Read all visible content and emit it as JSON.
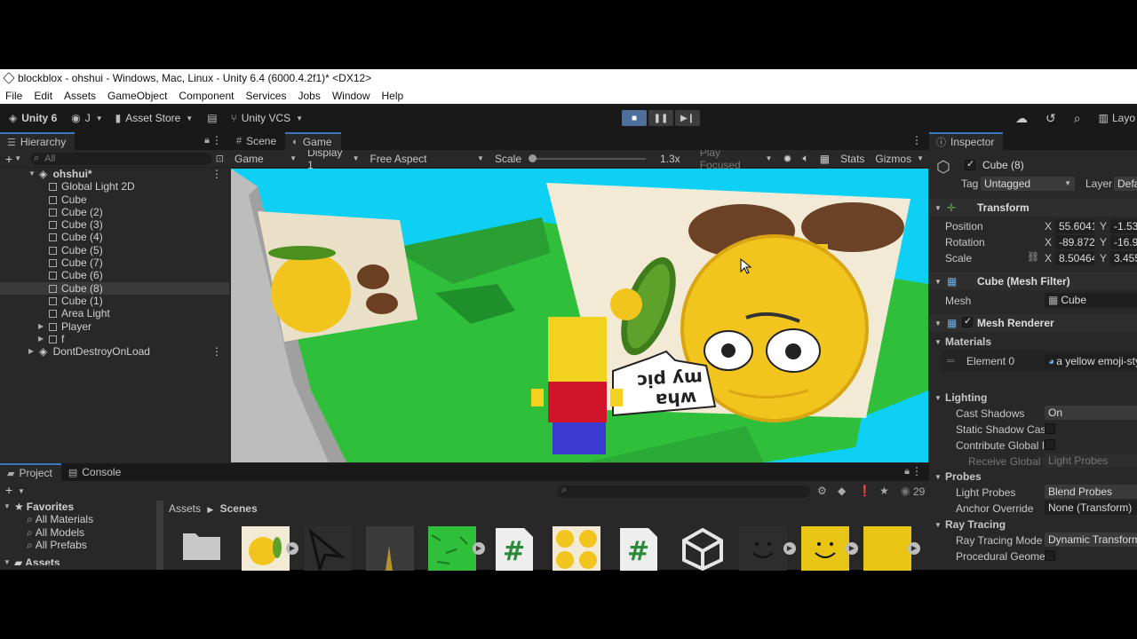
{
  "window": {
    "title": "blockblox - ohshui - Windows, Mac, Linux - Unity 6.4 (6000.4.2f1)* <DX12>"
  },
  "menu": [
    "File",
    "Edit",
    "Assets",
    "GameObject",
    "Component",
    "Services",
    "Jobs",
    "Window",
    "Help"
  ],
  "toolbar": {
    "unity_label": "Unity 6",
    "account_label": "J",
    "asset_store_label": "Asset Store",
    "vcs_label": "Unity VCS",
    "layout_label": "Layo"
  },
  "hierarchy": {
    "tab_label": "Hierarchy",
    "search_placeholder": "All",
    "scene_name": "ohshui*",
    "items": [
      "Global Light 2D",
      "Cube",
      "Cube (2)",
      "Cube (3)",
      "Cube (4)",
      "Cube (5)",
      "Cube (7)",
      "Cube (6)",
      "Cube (8)",
      "Cube (1)",
      "Area Light",
      "Player",
      "f"
    ],
    "selected_item": "Cube (8)",
    "dont_destroy": "DontDestroyOnLoad"
  },
  "game": {
    "tabs": [
      "Scene",
      "Game"
    ],
    "active_tab": "Game",
    "mode": "Game",
    "display": "Display 1",
    "aspect": "Free Aspect",
    "scale_label": "Scale",
    "scale_value": "1.3x",
    "play_focused": "Play Focused",
    "stats": "Stats",
    "gizmos": "Gizmos",
    "bubble_text_top": "my pic",
    "bubble_text_bottom": "wha"
  },
  "inspector": {
    "tab_label": "Inspector",
    "object_name": "Cube (8)",
    "tag_label": "Tag",
    "tag_value": "Untagged",
    "layer_label": "Layer",
    "layer_value": "Defa",
    "transform": {
      "title": "Transform",
      "position_label": "Position",
      "rotation_label": "Rotation",
      "scale_label": "Scale",
      "position_x": "55.6041",
      "position_y": "-1.53",
      "rotation_x": "-89.872",
      "rotation_y": "-16.9",
      "scale_x": "8.50464",
      "scale_y": "3.455"
    },
    "mesh_filter": {
      "title": "Cube (Mesh Filter)",
      "mesh_label": "Mesh",
      "mesh_value": "Cube"
    },
    "mesh_renderer": {
      "title": "Mesh Renderer",
      "materials_label": "Materials",
      "element_label": "Element 0",
      "element_value": "a yellow emoji-sty"
    },
    "lighting": {
      "title": "Lighting",
      "cast_shadows_label": "Cast Shadows",
      "cast_shadows_value": "On",
      "static_shadow_label": "Static Shadow Cast",
      "contribute_gi_label": "Contribute Global Il",
      "receive_gi_label": "Receive Global Il",
      "receive_gi_value": "Light Probes"
    },
    "probes": {
      "title": "Probes",
      "light_probes_label": "Light Probes",
      "light_probes_value": "Blend Probes",
      "anchor_label": "Anchor Override",
      "anchor_value": "None (Transform)"
    },
    "ray_tracing": {
      "title": "Ray Tracing",
      "mode_label": "Ray Tracing Mode",
      "mode_value": "Dynamic Transform",
      "procedural_label": "Procedural Geomet"
    }
  },
  "project": {
    "tabs": [
      "Project",
      "Console"
    ],
    "favorites_label": "Favorites",
    "favorites": [
      "All Materials",
      "All Models",
      "All Prefabs"
    ],
    "assets_label": "Assets",
    "breadcrumb": [
      "Assets",
      "Scenes"
    ],
    "count": "29"
  },
  "colors": {
    "accent": "#3a79bb",
    "sky": "#0dd0f4",
    "ground": "#2fbf3a",
    "emoji": "#f2c51e"
  }
}
